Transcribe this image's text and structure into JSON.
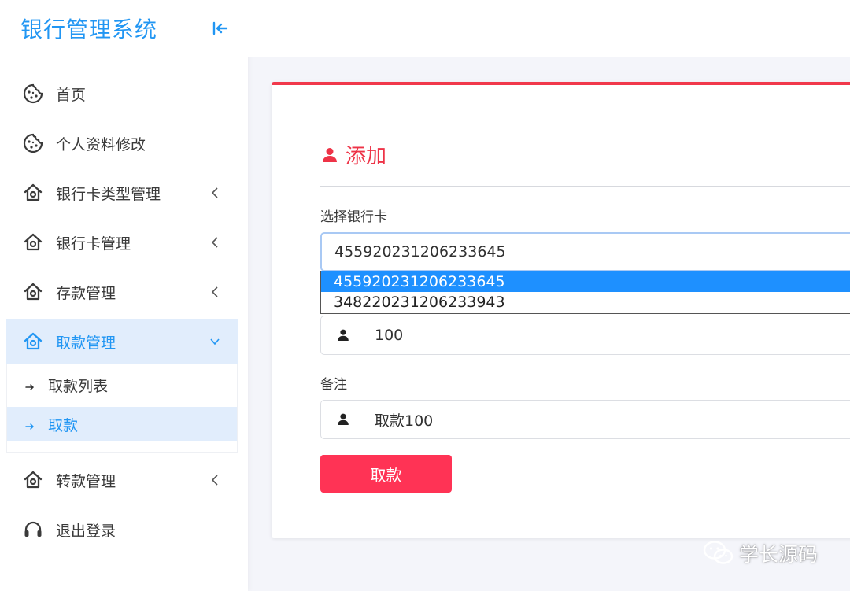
{
  "app": {
    "title": "银行管理系统"
  },
  "sidebar": {
    "items": [
      {
        "label": "首页",
        "icon": "cookie-icon",
        "has_children": false
      },
      {
        "label": "个人资料修改",
        "icon": "cookie-icon",
        "has_children": false
      },
      {
        "label": "银行卡类型管理",
        "icon": "home-icon",
        "has_children": true
      },
      {
        "label": "银行卡管理",
        "icon": "home-icon",
        "has_children": true
      },
      {
        "label": "存款管理",
        "icon": "home-icon",
        "has_children": true
      },
      {
        "label": "取款管理",
        "icon": "home-icon",
        "has_children": true,
        "active": true,
        "children": [
          {
            "label": "取款列表"
          },
          {
            "label": "取款",
            "active": true
          }
        ]
      },
      {
        "label": "转款管理",
        "icon": "home-icon",
        "has_children": true
      },
      {
        "label": "退出登录",
        "icon": "headset-icon",
        "has_children": false
      }
    ]
  },
  "form": {
    "title": "添加",
    "card_label": "选择银行卡",
    "card_value": "455920231206233645",
    "card_options": [
      "455920231206233645",
      "348220231206233943"
    ],
    "amount_value": "100",
    "remark_label": "备注",
    "remark_value": "取款100",
    "submit_label": "取款"
  },
  "watermark": {
    "text": "学长源码"
  },
  "colors": {
    "brand": "#2196f3",
    "accent": "#f1384b",
    "button": "#ff3355",
    "active_bg": "#e1edfc",
    "dropdown_selected": "#1e90ff"
  }
}
